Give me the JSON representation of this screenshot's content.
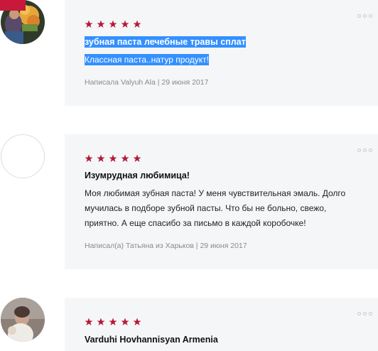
{
  "colors": {
    "star": "#b5193a",
    "card_bg": "#f5f6f8",
    "selection": "#3390ff",
    "meta": "#8a8a8a",
    "corner_badge": "#c8193c"
  },
  "reviews": [
    {
      "rating": 5,
      "title": "зубная паста лечебные травы сплат",
      "body": "Классная паста..натур продукт!",
      "author_line": "Написала Valyuh Ala",
      "date": "29 июня 2017"
    },
    {
      "rating": 5,
      "title": "Изумрудная любимица!",
      "body": "Моя любимая зубная паста! У меня чувствительная эмаль. Долго мучилась в подборе зубной пасты. Что бы не больно, свежо, приятно. А еще спасибо за письмо в каждой коробочке!",
      "author_line": "Написал(а) Татьяна из Харьков",
      "date": "29 июня 2017"
    },
    {
      "rating": 5,
      "title": "Varduhi Hovhannisyan Armenia"
    }
  ]
}
